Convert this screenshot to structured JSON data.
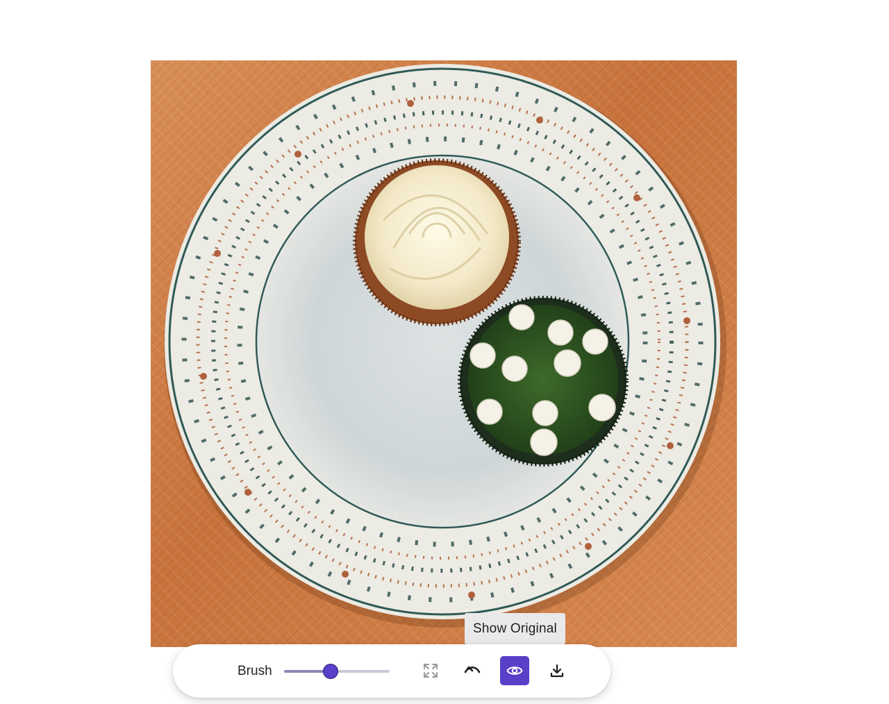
{
  "tooltip": {
    "text": "Show Original"
  },
  "toolbar": {
    "brush_label": "Brush",
    "brush_size_fraction": 0.44,
    "buttons": [
      {
        "name": "expand",
        "icon": "expand-icon",
        "active": false
      },
      {
        "name": "undo",
        "icon": "undo-icon",
        "active": false
      },
      {
        "name": "show-original",
        "icon": "eye-icon",
        "active": true
      },
      {
        "name": "download",
        "icon": "download-icon",
        "active": false
      }
    ]
  },
  "colors": {
    "accent": "#5a3fc9",
    "tooltip_bg": "#e9e9ea",
    "icon": "#1d1d1f",
    "slider_track": "#c9c8d6"
  }
}
